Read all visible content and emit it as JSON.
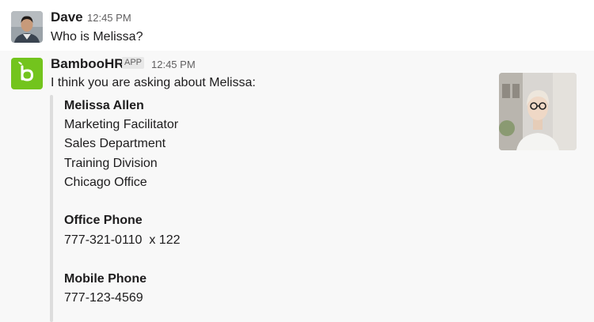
{
  "messages": [
    {
      "sender": "Dave",
      "time": "12:45 PM",
      "text": "Who is Melissa?"
    },
    {
      "sender": "BambooHR",
      "badge": "APP",
      "time": "12:45 PM",
      "text": "I think you are asking about Melissa:",
      "card": {
        "name": "Melissa Allen",
        "title": "Marketing Facilitator",
        "department": "Sales Department",
        "division": "Training Division",
        "office": "Chicago Office",
        "office_phone_label": "Office Phone",
        "office_phone": "777-321-0110  x 122",
        "mobile_phone_label": "Mobile Phone",
        "mobile_phone": "777-123-4569"
      }
    }
  ],
  "colors": {
    "bamboo_green": "#73c41d",
    "text": "#1d1c1d",
    "muted": "#616061"
  },
  "icons": {
    "bamboohr_logo": "bamboohr-logo-icon"
  }
}
